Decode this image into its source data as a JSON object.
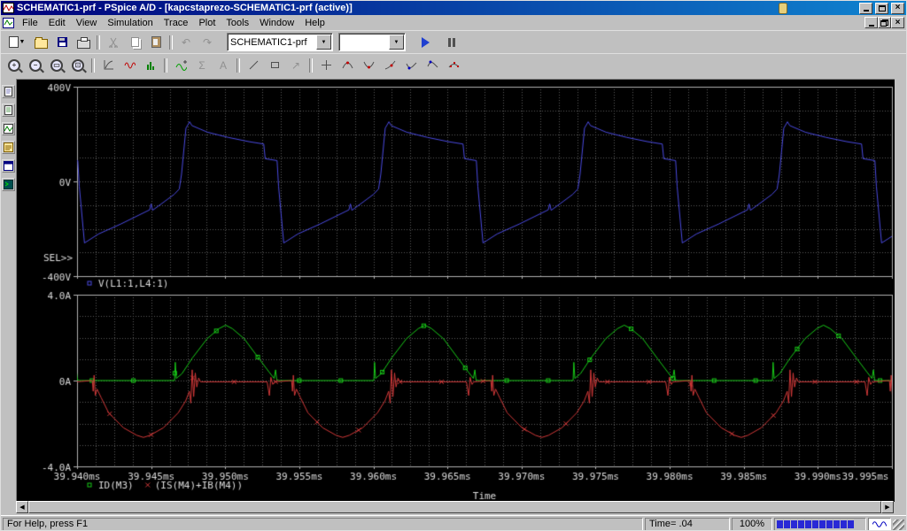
{
  "window": {
    "title": "SCHEMATIC1-prf - PSpice A/D  - [kapcstaprezo-SCHEMATIC1-prf (active)]"
  },
  "menu": {
    "items": [
      "File",
      "Edit",
      "View",
      "Simulation",
      "Trace",
      "Plot",
      "Tools",
      "Window",
      "Help"
    ]
  },
  "toolbar1": {
    "profile_combo_value": "SCHEMATIC1-prf",
    "secondary_combo_value": ""
  },
  "statusbar": {
    "help": "For Help, press F1",
    "time": "Time= .04",
    "zoom": "100%"
  },
  "icons": {
    "dropdown_arrow": "▼",
    "close_glyph": "×",
    "undo_glyph": "↶",
    "redo_glyph": "↷",
    "zoom_in_glyph": "+",
    "zoom_out_glyph": "−",
    "zoom_area_glyph": "▭",
    "zoom_fit_glyph": "⊡",
    "sigma_glyph": "Σ",
    "label_glyph": "A",
    "arrow_glyph": "↗",
    "scroll_left_glyph": "◀",
    "scroll_right_glyph": "▶"
  },
  "chart_data": {
    "type": "line",
    "xlabel": "Time",
    "sel_label": "SEL>>",
    "x_unit": "ms",
    "x_start_us": 0,
    "x_end_us": 55,
    "x_minor_step_us": 1.25,
    "period_us": 13.45,
    "x_ticks": [
      {
        "t": 0,
        "label": "39.940ms"
      },
      {
        "t": 5,
        "label": "39.945ms"
      },
      {
        "t": 10,
        "label": "39.950ms"
      },
      {
        "t": 15,
        "label": "39.955ms"
      },
      {
        "t": 20,
        "label": "39.960ms"
      },
      {
        "t": 25,
        "label": "39.965ms"
      },
      {
        "t": 30,
        "label": "39.970ms"
      },
      {
        "t": 35,
        "label": "39.975ms"
      },
      {
        "t": 40,
        "label": "39.980ms"
      },
      {
        "t": 45,
        "label": "39.985ms"
      },
      {
        "t": 50,
        "label": "39.990ms"
      },
      {
        "t": 55,
        "label": "39.995ms"
      }
    ],
    "plots": [
      {
        "name": "voltage",
        "ylim": [
          -400,
          400
        ],
        "y_minor": 100,
        "yticks": [
          {
            "v": 400,
            "label": "400V"
          },
          {
            "v": 0,
            "label": "0V"
          },
          {
            "v": -400,
            "label": "-400V"
          }
        ],
        "series": [
          {
            "label": "V(L1:1,L4:1)",
            "color": "#4a4ae0",
            "marker": "square",
            "phase_us": 7.6,
            "points": [
              [
                0,
                252
              ],
              [
                0.15,
                236
              ],
              [
                1.2,
                208
              ],
              [
                2.6,
                186
              ],
              [
                4,
                168
              ],
              [
                5,
                158
              ],
              [
                5.1,
                96
              ],
              [
                5.9,
                88
              ],
              [
                6,
                -20
              ],
              [
                6.35,
                -260
              ],
              [
                7.3,
                -222
              ],
              [
                8.8,
                -180
              ],
              [
                10.75,
                -120
              ],
              [
                10.85,
                -95
              ],
              [
                10.95,
                -122
              ],
              [
                12.4,
                -55
              ],
              [
                12.75,
                -32
              ],
              [
                12.9,
                30
              ],
              [
                13.2,
                225
              ],
              [
                13.45,
                252
              ]
            ]
          }
        ]
      },
      {
        "name": "current",
        "ylim": [
          -4,
          4
        ],
        "y_minor": 1,
        "yticks": [
          {
            "v": 4,
            "label": "4.0A"
          },
          {
            "v": 0,
            "label": "0A"
          },
          {
            "v": -4,
            "label": "-4.0A"
          }
        ],
        "series": [
          {
            "label": "ID(M3)",
            "color": "#18c818",
            "marker": "square",
            "marker_start_us": 1.0,
            "marker_step_us": 2.8,
            "phase_us": -6.87,
            "points": [
              [
                0,
                0
              ],
              [
                0.05,
                0.85
              ],
              [
                0.12,
                0.1
              ],
              [
                0.5,
                0.32
              ],
              [
                1.2,
                1.05
              ],
              [
                2.2,
                1.95
              ],
              [
                3,
                2.42
              ],
              [
                3.45,
                2.58
              ],
              [
                3.9,
                2.42
              ],
              [
                4.7,
                1.95
              ],
              [
                5.7,
                1.02
              ],
              [
                6.4,
                0.38
              ],
              [
                6.72,
                0.1
              ],
              [
                6.82,
                0.5
              ],
              [
                6.9,
                0.02
              ],
              [
                7.1,
                0
              ],
              [
                13.45,
                0
              ]
            ]
          },
          {
            "label": "(IS(M4)+IB(M4))",
            "color": "#d03838",
            "marker": "x",
            "marker_start_us": 2.2,
            "marker_step_us": 2.8,
            "phase_us": 1.03,
            "points": [
              [
                0,
                0
              ],
              [
                0.06,
                -0.5
              ],
              [
                0.12,
                0.25
              ],
              [
                0.2,
                -0.7
              ],
              [
                0.32,
                -0.4
              ],
              [
                0.6,
                -0.8
              ],
              [
                1.1,
                -1.5
              ],
              [
                2.1,
                -2.2
              ],
              [
                3,
                -2.55
              ],
              [
                3.45,
                -2.65
              ],
              [
                3.9,
                -2.55
              ],
              [
                4.8,
                -2.2
              ],
              [
                5.8,
                -1.5
              ],
              [
                6.3,
                -0.95
              ],
              [
                6.55,
                -0.5
              ],
              [
                6.65,
                -1.05
              ],
              [
                6.74,
                0.5
              ],
              [
                6.84,
                -0.75
              ],
              [
                6.95,
                0.35
              ],
              [
                7.05,
                -0.3
              ],
              [
                7.18,
                0.12
              ],
              [
                7.3,
                -0.06
              ],
              [
                9,
                -0.06
              ],
              [
                11.8,
                -0.06
              ],
              [
                11.95,
                -0.7
              ],
              [
                12.05,
                0.15
              ],
              [
                12.18,
                -0.18
              ],
              [
                12.3,
                -0.06
              ],
              [
                13.45,
                0
              ]
            ]
          }
        ]
      }
    ]
  }
}
